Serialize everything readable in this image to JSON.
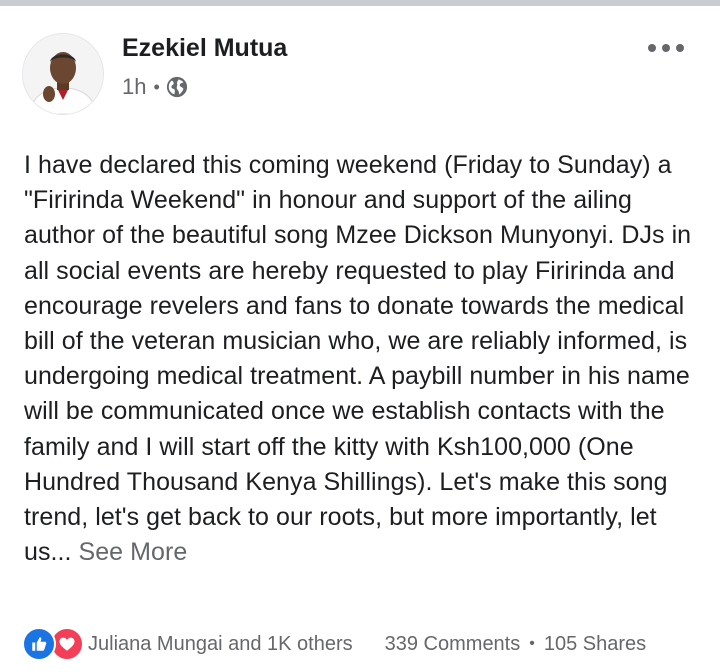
{
  "post": {
    "author": "Ezekiel Mutua",
    "time": "1h",
    "privacy_icon": "globe-icon",
    "menu_icon": "more-icon",
    "body": "I have declared this coming weekend (Friday to Sunday) a \"Firirinda Weekend\" in honour and support of the ailing author of the beautiful song Mzee Dickson Munyonyi. DJs in all social events are hereby requested to play Firirinda and encourage revelers and fans to donate towards the medical bill of the veteran musician who, we are reliably informed, is undergoing medical treatment. A paybill number in his name will be communicated once we establish contacts with the family and I will start off the kitty with Ksh100,000 (One Hundred Thousand Kenya Shillings). Let's make this song trend, let's get back to our roots, but more importantly, let us...",
    "see_more": "See More"
  },
  "footer": {
    "reactions": [
      "like-icon",
      "love-icon"
    ],
    "reactors": "Juliana Mungai and 1K others",
    "comments": "339 Comments",
    "separator": "•",
    "shares": "105 Shares"
  },
  "colors": {
    "text": "#1c1e21",
    "secondary": "#65676b",
    "like": "#1b74e4",
    "love": "#f33e58",
    "top_bar": "#c9ccd1"
  }
}
